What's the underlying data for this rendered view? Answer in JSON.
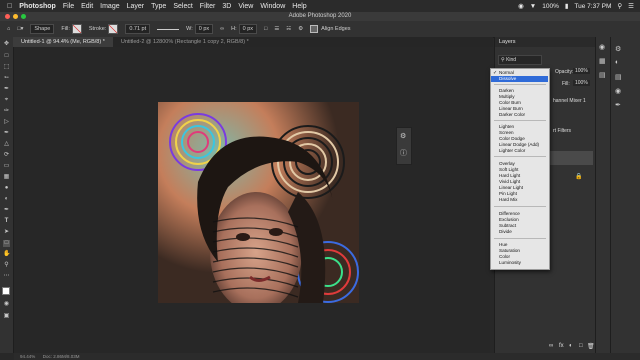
{
  "menubar": {
    "app": "Photoshop",
    "items": [
      "File",
      "Edit",
      "Image",
      "Layer",
      "Type",
      "Select",
      "Filter",
      "3D",
      "View",
      "Window",
      "Help"
    ],
    "battery": "100%",
    "clock": "Tue 7:37 PM"
  },
  "window": {
    "title": "Adobe Photoshop 2020"
  },
  "options": {
    "shape_mode": "Shape",
    "fill_label": "Fill:",
    "stroke_label": "Stroke:",
    "stroke_size": "0.71 pt",
    "w_label": "W:",
    "w_value": "0 px",
    "h_label": "H:",
    "h_value": "0 px",
    "align_edges": "Align Edges"
  },
  "tabs": [
    {
      "label": "Untitled-1 @ 94.4% (Me, RGB/8) *"
    },
    {
      "label": "Untitled-2 @ 12800% (Rectangle 1 copy 2, RGB/8) *"
    }
  ],
  "layers_panel": {
    "title": "Layers",
    "kind": "Kind",
    "opacity_label": "Opacity:",
    "opacity_value": "100%",
    "fill_label": "Fill:",
    "fill_value": "100%",
    "layer_fragment_1": "hannel Mixer 1",
    "layer_fragment_2": "rt Filters"
  },
  "blend_dropdown": {
    "groups": [
      [
        "Normal",
        "Dissolve"
      ],
      [
        "Darken",
        "Multiply",
        "Color Burn",
        "Linear Burn",
        "Darker Color"
      ],
      [
        "Lighten",
        "Screen",
        "Color Dodge",
        "Linear Dodge (Add)",
        "Lighter Color"
      ],
      [
        "Overlay",
        "Soft Light",
        "Hard Light",
        "Vivid Light",
        "Linear Light",
        "Pin Light",
        "Hard Mix"
      ],
      [
        "Difference",
        "Exclusion",
        "Subtract",
        "Divide"
      ],
      [
        "Hue",
        "Saturation",
        "Color",
        "Luminosity"
      ]
    ],
    "checked": "Normal",
    "highlighted": "Dissolve"
  },
  "status": {
    "zoom": "94.44%",
    "doc": "Doc: 2.86M/8.03M"
  },
  "colors": {
    "accent": "#2f6bd8",
    "panel": "#323232"
  }
}
